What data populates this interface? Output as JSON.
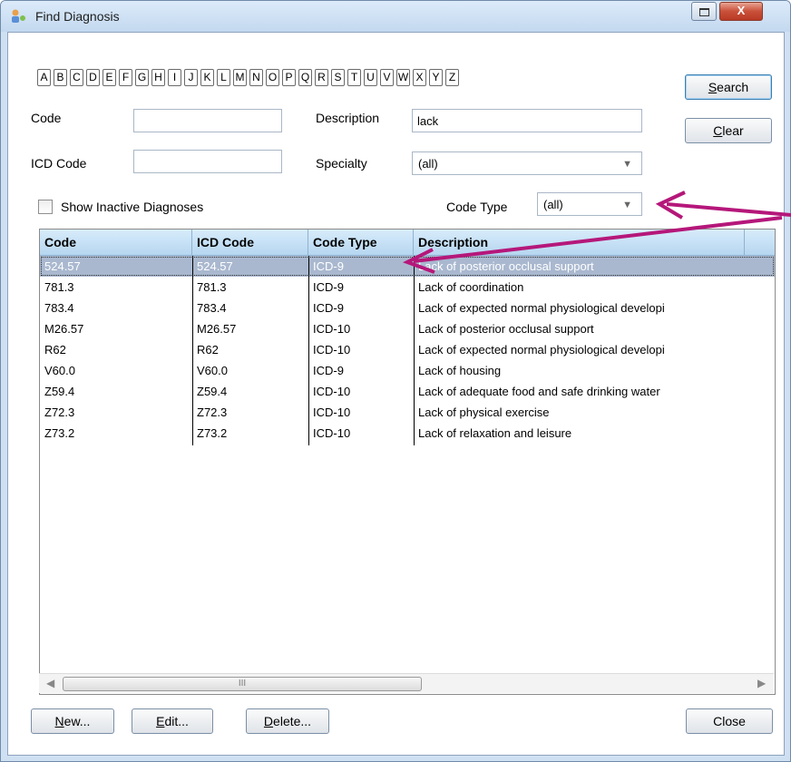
{
  "window": {
    "title": "Find Diagnosis",
    "close_glyph": "X"
  },
  "letters": [
    "A",
    "B",
    "C",
    "D",
    "E",
    "F",
    "G",
    "H",
    "I",
    "J",
    "K",
    "L",
    "M",
    "N",
    "O",
    "P",
    "Q",
    "R",
    "S",
    "T",
    "U",
    "V",
    "W",
    "X",
    "Y",
    "Z"
  ],
  "form": {
    "code_label": "Code",
    "code_value": "",
    "icd_label": "ICD Code",
    "icd_value": "",
    "description_label": "Description",
    "description_value": "lack",
    "specialty_label": "Specialty",
    "specialty_value": "(all)",
    "show_inactive_label": "Show Inactive Diagnoses",
    "show_inactive_checked": false,
    "code_type_label": "Code Type",
    "code_type_value": "(all)"
  },
  "buttons": {
    "search_u": "S",
    "search_rest": "earch",
    "clear_u": "C",
    "clear_rest": "lear",
    "new_u": "N",
    "new_rest": "ew...",
    "edit_u": "E",
    "edit_rest": "dit...",
    "delete_u": "D",
    "delete_rest": "elete...",
    "close": "Close"
  },
  "table": {
    "columns": [
      "Code",
      "ICD Code",
      "Code Type",
      "Description"
    ],
    "rows": [
      {
        "code": "524.57",
        "icd": "524.57",
        "type": "ICD-9",
        "desc": "Lack of posterior occlusal support",
        "selected": true
      },
      {
        "code": "781.3",
        "icd": "781.3",
        "type": "ICD-9",
        "desc": "Lack of coordination"
      },
      {
        "code": "783.4",
        "icd": "783.4",
        "type": "ICD-9",
        "desc": "Lack of expected normal physiological developi"
      },
      {
        "code": "M26.57",
        "icd": "M26.57",
        "type": "ICD-10",
        "desc": "Lack of posterior occlusal support"
      },
      {
        "code": "R62",
        "icd": "R62",
        "type": "ICD-10",
        "desc": "Lack of expected normal physiological developi"
      },
      {
        "code": "V60.0",
        "icd": "V60.0",
        "type": "ICD-9",
        "desc": "Lack of housing"
      },
      {
        "code": "Z59.4",
        "icd": "Z59.4",
        "type": "ICD-10",
        "desc": "Lack of adequate food and safe drinking water"
      },
      {
        "code": "Z72.3",
        "icd": "Z72.3",
        "type": "ICD-10",
        "desc": "Lack of physical exercise"
      },
      {
        "code": "Z73.2",
        "icd": "Z73.2",
        "type": "ICD-10",
        "desc": "Lack of relaxation and leisure"
      }
    ]
  },
  "scrollbar": {
    "thumb_grip": "III"
  },
  "annotation_color": "#b5177a"
}
